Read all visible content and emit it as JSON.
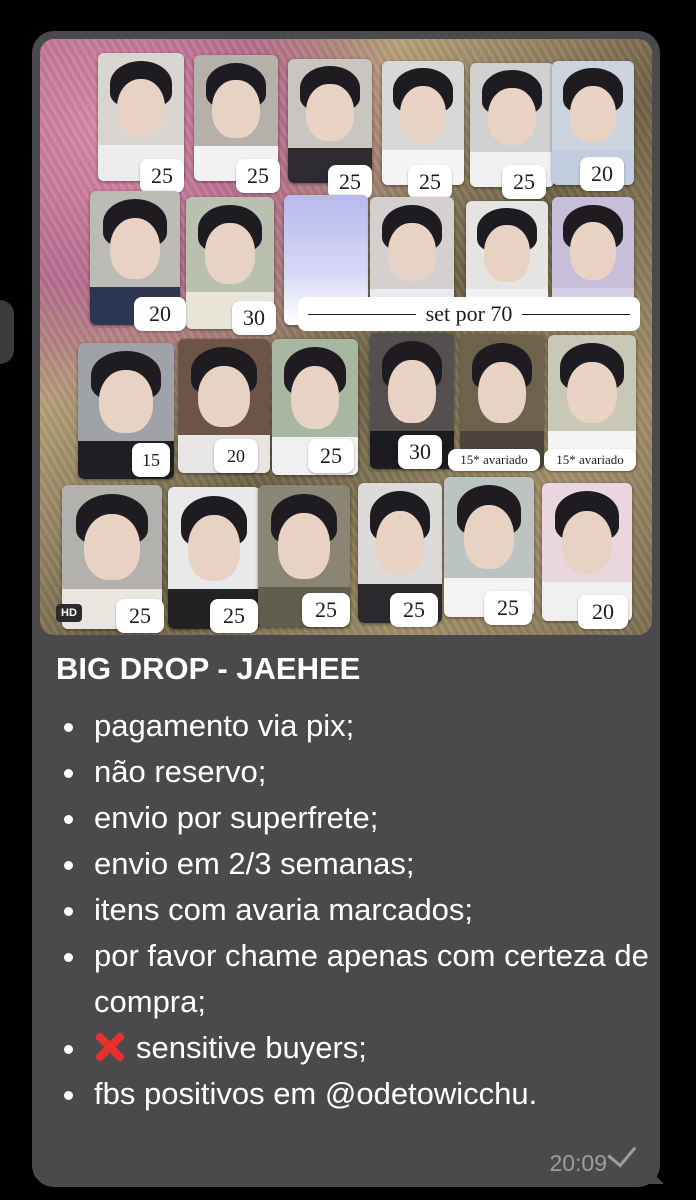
{
  "message": {
    "title": "BIG DROP - JAEHEE",
    "rules": [
      "pagamento via pix;",
      "não reservo;",
      "envio por superfrete;",
      "envio em 2/3 semanas;",
      "itens com avaria marcados;",
      "por favor chame apenas com certeza de compra;",
      "sensitive buyers;",
      "fbs positivos em @odetowicchu."
    ],
    "rule_icon": "cross-mark-icon",
    "timestamp": "20:09",
    "status_icon": "checkmark-icon"
  },
  "photo": {
    "badge": "HD",
    "prices": [
      "25",
      "25",
      "25",
      "25",
      "25",
      "20",
      "20",
      "30",
      "15",
      "20",
      "25",
      "30",
      "15* avariado",
      "15* avariado",
      "25",
      "25",
      "25",
      "25",
      "25",
      "20"
    ],
    "set_label": "set por 70"
  },
  "colors": {
    "background": "#000000",
    "bubble": "#4a4a4c",
    "text": "#ffffff",
    "timestamp": "#9d9d9f",
    "cross": "#e8312f"
  }
}
